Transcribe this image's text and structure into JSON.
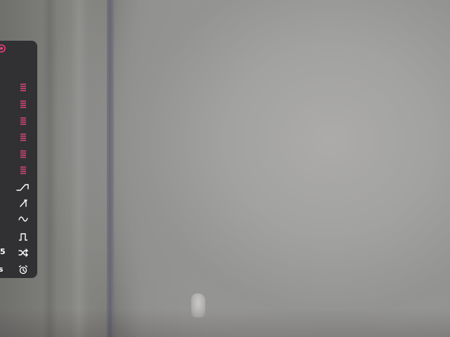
{
  "panel": {
    "items": [
      {
        "icon": "record-icon"
      },
      {
        "icon": "list-icon"
      },
      {
        "icon": "list-icon"
      },
      {
        "icon": "list-icon"
      },
      {
        "icon": "list-icon"
      },
      {
        "icon": "list-icon"
      },
      {
        "icon": "list-icon"
      },
      {
        "icon": "ramp-up-icon"
      },
      {
        "icon": "sawtooth-icon"
      },
      {
        "icon": "sine-wave-icon"
      },
      {
        "icon": "square-wave-icon",
        "value": "5"
      },
      {
        "icon": "shuffle-icon"
      },
      {
        "icon": "alarm-clock-icon",
        "value": "s"
      }
    ]
  },
  "colors": {
    "accent": "#e0457b",
    "icon_white": "#ffffff",
    "panel_bg": "#2c2c2e"
  }
}
